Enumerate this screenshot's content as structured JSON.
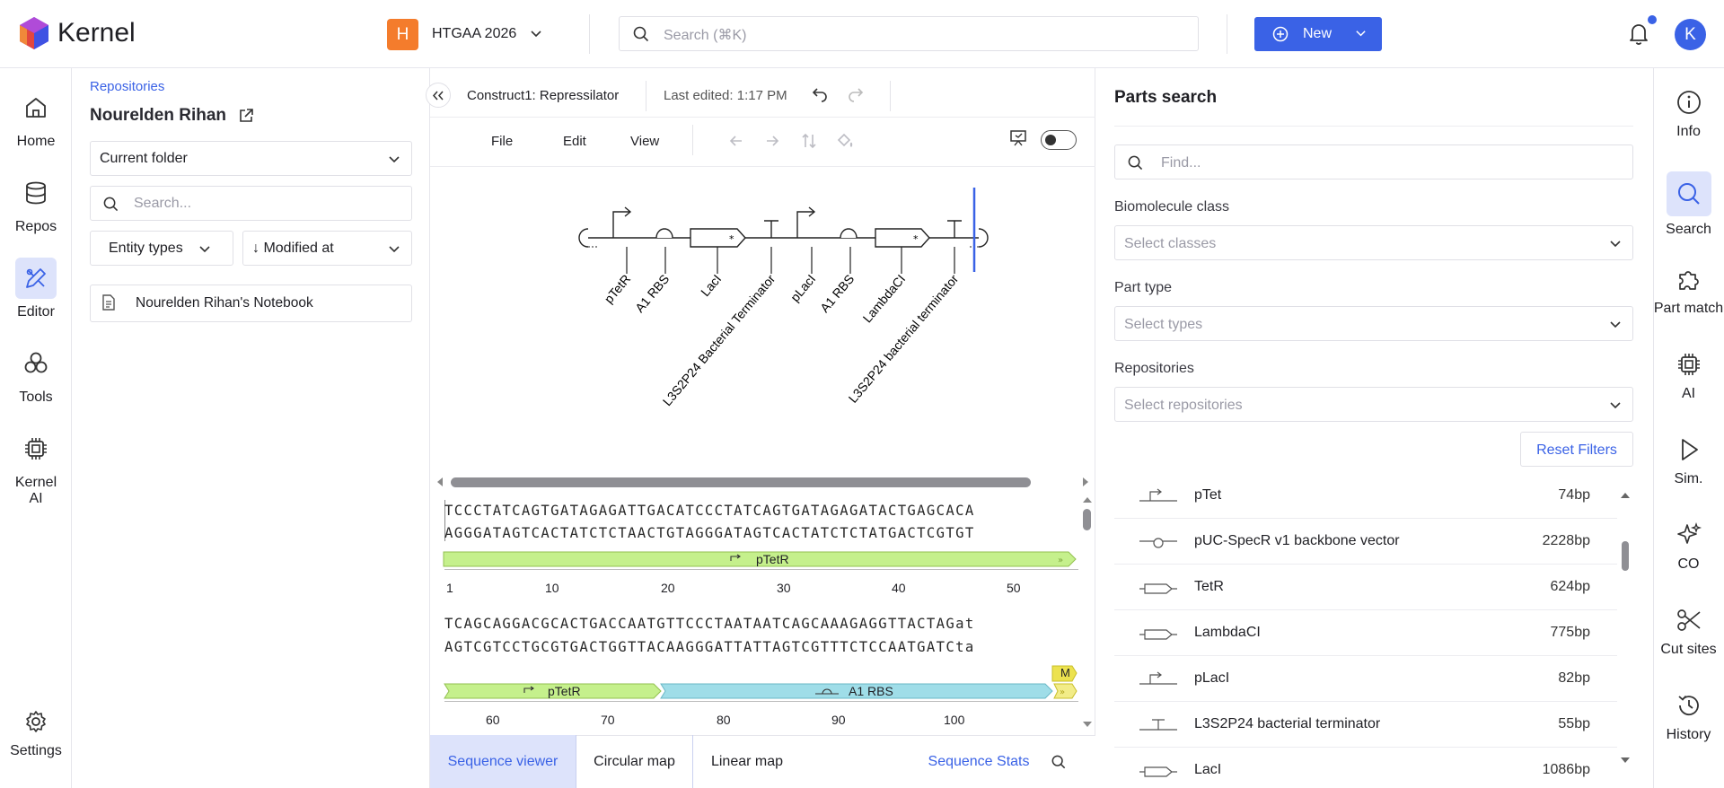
{
  "header": {
    "app_title": "Kernel",
    "project_initial": "H",
    "project_name": "HTGAA 2026",
    "search_placeholder": "Search (⌘K)",
    "new_label": "New",
    "avatar_initial": "K",
    "icons": [
      "kernel-logo-icon",
      "chevron-down-icon",
      "search-icon",
      "plus-circle-icon",
      "bell-icon"
    ],
    "accent_color": "#3a62e6",
    "project_color": "#f47c2c"
  },
  "left_nav": {
    "items": [
      {
        "label": "Home",
        "icon": "home-icon"
      },
      {
        "label": "Repos",
        "icon": "database-icon"
      },
      {
        "label": "Editor",
        "icon": "editor-icon",
        "active": true
      },
      {
        "label": "Tools",
        "icon": "tools-icon"
      },
      {
        "label": "Kernel",
        "label2": "AI",
        "icon": "chip-icon"
      },
      {
        "label": "Settings",
        "icon": "gear-icon"
      }
    ]
  },
  "repo_panel": {
    "breadcrumb": "Repositories",
    "owner": "Nourelden Rihan",
    "folder_select": "Current folder",
    "search_placeholder": "Search...",
    "entity_types": "Entity types",
    "modified_at": "↓ Modified at",
    "items": [
      "Nourelden Rihan's Notebook"
    ]
  },
  "editor": {
    "construct_title": "Construct1: Repressilator",
    "last_edited": "Last edited: 1:17 PM",
    "menus": [
      "File",
      "Edit",
      "View"
    ],
    "map_parts": [
      "pTetR",
      "A1 RBS",
      "LacI",
      "L3S2P24 Bacterial Terminator",
      "pLacI",
      "A1 RBS",
      "LambdaCI",
      "L3S2P24 bacterial terminator"
    ],
    "sequence_rows": [
      {
        "top": "TCCCTATCAGTGATAGAGATTGACATCCCTATCAGTGATAGAGATACTGAGCACA",
        "bottom": "AGGGATAGTCACTATCTCTAACTGTAGGGATAGTCACTATCTCTATGACTCGTGT",
        "features": [
          {
            "name": "pTetR",
            "color": "#c5f08c"
          }
        ],
        "ticks": [
          "1",
          "10",
          "20",
          "30",
          "40",
          "50"
        ]
      },
      {
        "top": "TCAGCAGGACGCACTGACCAATGTTCCCTAATAATCAGCAAAGAGGTTACTAGat",
        "bottom": "AGTCGTCCTGCGTGACTGGTTACAAGGGATTATTAGTCGTTTCTCCAATGATCta",
        "features": [
          {
            "name": "pTetR",
            "color": "#c5f08c"
          },
          {
            "name": "A1 RBS",
            "color": "#9fdde8"
          },
          {
            "name": "M",
            "color": "#ece24f"
          }
        ],
        "ticks": [
          "60",
          "70",
          "80",
          "90",
          "100"
        ]
      }
    ],
    "bottom_tabs": [
      "Sequence viewer",
      "Circular map",
      "Linear map"
    ],
    "sequence_stats": "Sequence Stats"
  },
  "parts_search": {
    "title": "Parts search",
    "find_placeholder": "Find...",
    "biomolecule_label": "Biomolecule class",
    "biomolecule_placeholder": "Select classes",
    "part_type_label": "Part type",
    "part_type_placeholder": "Select types",
    "repositories_label": "Repositories",
    "repositories_placeholder": "Select repositories",
    "reset_label": "Reset Filters",
    "results": [
      {
        "name": "pTet",
        "size": "74bp",
        "glyph": "promoter-icon"
      },
      {
        "name": "pUC-SpecR v1 backbone vector",
        "size": "2228bp",
        "glyph": "origin-icon"
      },
      {
        "name": "TetR",
        "size": "624bp",
        "glyph": "cds-icon"
      },
      {
        "name": "LambdaCI",
        "size": "775bp",
        "glyph": "cds-icon"
      },
      {
        "name": "pLacI",
        "size": "82bp",
        "glyph": "promoter-icon"
      },
      {
        "name": "L3S2P24 bacterial terminator",
        "size": "55bp",
        "glyph": "terminator-icon"
      },
      {
        "name": "LacI",
        "size": "1086bp",
        "glyph": "cds-icon"
      }
    ]
  },
  "right_rail": {
    "items": [
      {
        "label": "Info",
        "icon": "info-icon"
      },
      {
        "label": "Search",
        "icon": "search-icon",
        "active": true
      },
      {
        "label": "Part match",
        "icon": "puzzle-icon"
      },
      {
        "label": "AI",
        "icon": "chip-icon"
      },
      {
        "label": "Sim.",
        "icon": "play-icon"
      },
      {
        "label": "CO",
        "icon": "sparkle-icon"
      },
      {
        "label": "Cut sites",
        "icon": "scissors-icon"
      },
      {
        "label": "History",
        "icon": "history-icon"
      }
    ]
  }
}
